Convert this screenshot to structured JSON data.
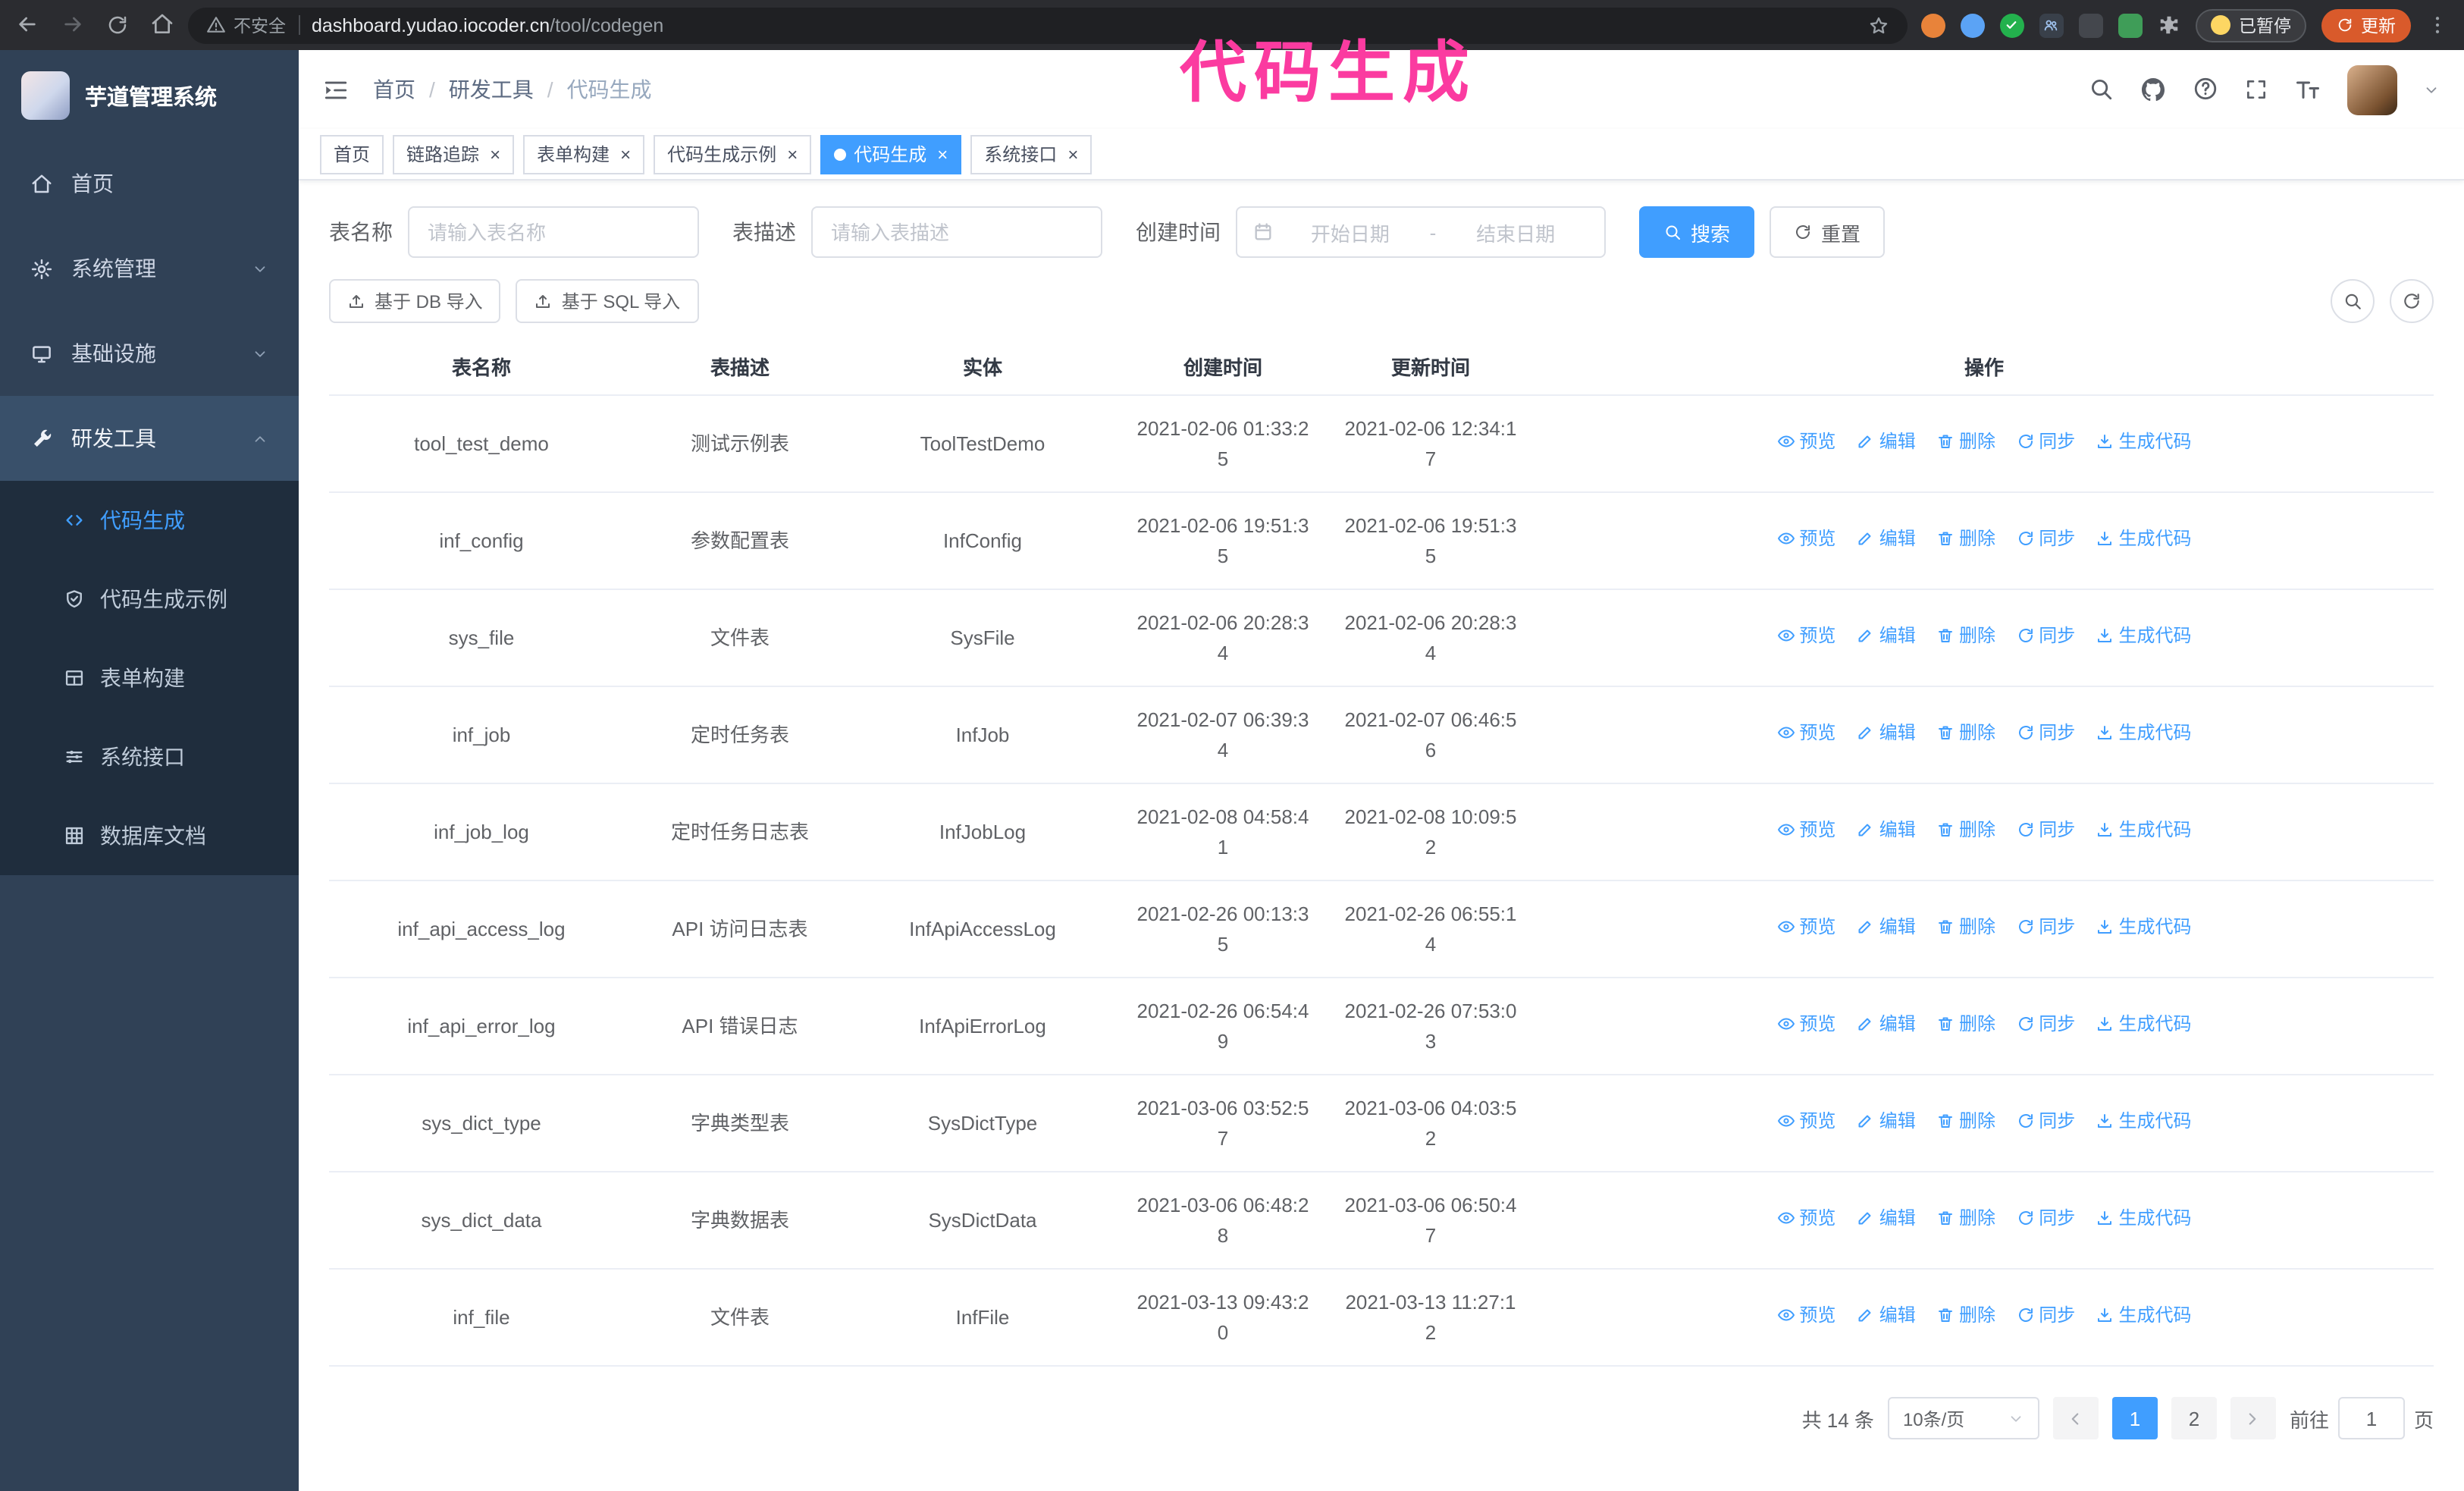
{
  "colors": {
    "accent": "#409eff",
    "sidebar-bg": "#304156",
    "submenu-bg": "#1f2d3d",
    "annotation": "#fb3ba0",
    "chrome-bg": "#2b2c30",
    "update-pill": "#d95a2b"
  },
  "browser": {
    "security_label": "不安全",
    "url_host": "dashboard.yudao.iocoder.cn",
    "url_path": "/tool/codegen",
    "paused_badge": "已暂停",
    "update_button": "更新"
  },
  "annotation": {
    "text": "代码生成"
  },
  "sidebar": {
    "logo_title": "芋道管理系统",
    "items": [
      {
        "label": "首页"
      },
      {
        "label": "系统管理"
      },
      {
        "label": "基础设施"
      },
      {
        "label": "研发工具"
      }
    ],
    "submenu": [
      {
        "label": "代码生成"
      },
      {
        "label": "代码生成示例"
      },
      {
        "label": "表单构建"
      },
      {
        "label": "系统接口"
      },
      {
        "label": "数据库文档"
      }
    ]
  },
  "breadcrumb": {
    "separator": "/",
    "items": [
      "首页",
      "研发工具",
      "代码生成"
    ]
  },
  "tabs": [
    {
      "label": "首页"
    },
    {
      "label": "链路追踪"
    },
    {
      "label": "表单构建"
    },
    {
      "label": "代码生成示例"
    },
    {
      "label": "代码生成"
    },
    {
      "label": "系统接口"
    }
  ],
  "filters": {
    "table_name_label": "表名称",
    "table_name_placeholder": "请输入表名称",
    "table_desc_label": "表描述",
    "table_desc_placeholder": "请输入表描述",
    "create_time_label": "创建时间",
    "date_start_placeholder": "开始日期",
    "date_separator": "-",
    "date_end_placeholder": "结束日期",
    "search_button": "搜索",
    "reset_button": "重置"
  },
  "toolbar": {
    "import_db_button": "基于 DB 导入",
    "import_sql_button": "基于 SQL 导入"
  },
  "table": {
    "columns": [
      "表名称",
      "表描述",
      "实体",
      "创建时间",
      "更新时间",
      "操作"
    ],
    "action_labels": [
      "预览",
      "编辑",
      "删除",
      "同步",
      "生成代码"
    ],
    "rows": [
      {
        "name": "tool_test_demo",
        "desc": "测试示例表",
        "entity": "ToolTestDemo",
        "created": "2021-02-06 01:33:25",
        "updated": "2021-02-06 12:34:17"
      },
      {
        "name": "inf_config",
        "desc": "参数配置表",
        "entity": "InfConfig",
        "created": "2021-02-06 19:51:35",
        "updated": "2021-02-06 19:51:35"
      },
      {
        "name": "sys_file",
        "desc": "文件表",
        "entity": "SysFile",
        "created": "2021-02-06 20:28:34",
        "updated": "2021-02-06 20:28:34"
      },
      {
        "name": "inf_job",
        "desc": "定时任务表",
        "entity": "InfJob",
        "created": "2021-02-07 06:39:34",
        "updated": "2021-02-07 06:46:56"
      },
      {
        "name": "inf_job_log",
        "desc": "定时任务日志表",
        "entity": "InfJobLog",
        "created": "2021-02-08 04:58:41",
        "updated": "2021-02-08 10:09:52"
      },
      {
        "name": "inf_api_access_log",
        "desc": "API 访问日志表",
        "entity": "InfApiAccessLog",
        "created": "2021-02-26 00:13:35",
        "updated": "2021-02-26 06:55:14"
      },
      {
        "name": "inf_api_error_log",
        "desc": "API 错误日志",
        "entity": "InfApiErrorLog",
        "created": "2021-02-26 06:54:49",
        "updated": "2021-02-26 07:53:03"
      },
      {
        "name": "sys_dict_type",
        "desc": "字典类型表",
        "entity": "SysDictType",
        "created": "2021-03-06 03:52:57",
        "updated": "2021-03-06 04:03:52"
      },
      {
        "name": "sys_dict_data",
        "desc": "字典数据表",
        "entity": "SysDictData",
        "created": "2021-03-06 06:48:28",
        "updated": "2021-03-06 06:50:47"
      },
      {
        "name": "inf_file",
        "desc": "文件表",
        "entity": "InfFile",
        "created": "2021-03-13 09:43:20",
        "updated": "2021-03-13 11:27:12"
      }
    ]
  },
  "pagination": {
    "total_label": "共 14 条",
    "page_size_label": "10条/页",
    "pages": [
      "1",
      "2"
    ],
    "active_page": "1",
    "goto_label": "前往",
    "goto_value": "1",
    "goto_unit": "页"
  }
}
